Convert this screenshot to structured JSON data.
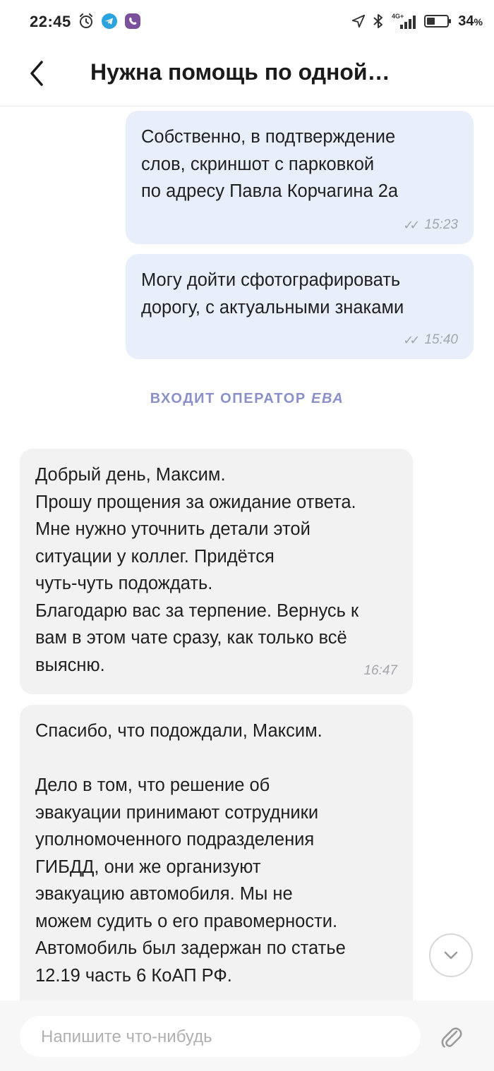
{
  "status_bar": {
    "time": "22:45",
    "battery_pct": "34",
    "battery_suffix": "%",
    "network_label": "4G+"
  },
  "header": {
    "title": "Нужна помощь по одной…"
  },
  "messages": [
    {
      "direction": "out",
      "text": "Собственно, в подтверждение\nслов, скриншот с парковкой\nпо адресу Павла Корчагина 2а",
      "time": "15:23",
      "read": true
    },
    {
      "direction": "out",
      "text": "Могу дойти сфотографировать\nдорогу, с актуальными знаками",
      "time": "15:40",
      "read": true
    },
    {
      "direction": "in",
      "text": "Добрый день, Максим.\nПрошу прощения за ожидание ответа.\nМне нужно уточнить детали этой\nситуации у коллег. Придётся\nчуть-чуть подождать.\nБлагодарю вас за терпение. Вернусь к\nвам в этом чате сразу, как только всё\nвыясню.",
      "time": "16:47"
    },
    {
      "direction": "in",
      "text": "Спасибо, что подождали, Максим.\n\nДело в том, что решение об\nэвакуации принимают сотрудники\nуполномоченного подразделения\nГИБДД, они же организуют\nэвакуацию автомобиля. Мы не\nможем судить о его правомерности.\nАвтомобиль был задержан по статье\n12.19 часть 6 КоАП РФ."
    }
  ],
  "system_note": {
    "prefix": "ВХОДИТ ОПЕРАТОР",
    "operator": "ЕВА"
  },
  "composer": {
    "placeholder": "Напишите что-нибудь"
  },
  "colors": {
    "outgoing_bubble": "#e8effb",
    "incoming_bubble": "#f2f2f3",
    "system_note": "#8a90c8",
    "telegram_blue": "#2aa3df",
    "viber_purple": "#7b519d"
  }
}
